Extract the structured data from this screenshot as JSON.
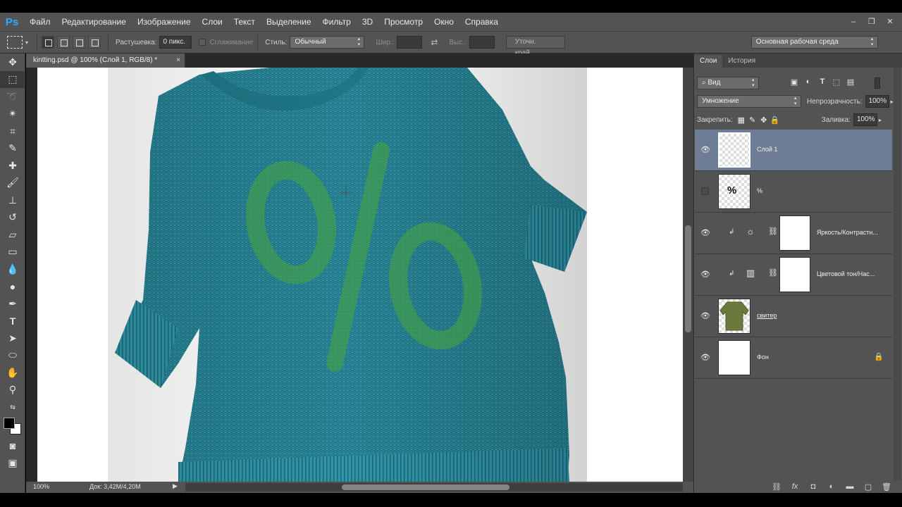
{
  "app": {
    "logo": "Ps"
  },
  "menu": [
    "Файл",
    "Редактирование",
    "Изображение",
    "Слои",
    "Текст",
    "Выделение",
    "Фильтр",
    "3D",
    "Просмотр",
    "Окно",
    "Справка"
  ],
  "window_controls": {
    "minimize": "–",
    "restore": "❐",
    "close": "✕"
  },
  "options": {
    "feather_label": "Растушевка:",
    "feather_value": "0 пикс.",
    "antialias_label": "Сглаживание",
    "style_label": "Стиль:",
    "style_value": "Обычный",
    "width_label": "Шир.:",
    "height_label": "Выс.:",
    "refine_edge": "Уточн. край...",
    "workspace": "Основная рабочая среда"
  },
  "document": {
    "tab_title": "kintting.psd @ 100% (Слой 1, RGB/8) *",
    "zoom": "100%",
    "doc_size": "Док: 3,42M/4,20M"
  },
  "panel": {
    "tabs": [
      "Слои",
      "История"
    ],
    "filter_kind": "Вид",
    "blend_mode": "Умножение",
    "opacity_label": "Непрозрачность:",
    "opacity_value": "100%",
    "lock_label": "Закрепить:",
    "fill_label": "Заливка:",
    "fill_value": "100%"
  },
  "layers": [
    {
      "name": "Слой 1",
      "visible": true,
      "selected": true
    },
    {
      "name": "%",
      "visible": false,
      "selected": false,
      "thumb_text": "%"
    },
    {
      "name": "Яркость/Контрастн...",
      "visible": true,
      "adjustment": true
    },
    {
      "name": "Цветовой тон/Нас...",
      "visible": true,
      "adjustment": true
    },
    {
      "name": "свитер",
      "visible": true,
      "underline": true
    },
    {
      "name": "Фон",
      "visible": true,
      "locked": true
    }
  ],
  "colors": {
    "sweater": "#2b8fa1",
    "percent_green": "#3b9a3a",
    "selected_layer": "#6f7c95",
    "ui_bg": "#535353"
  }
}
